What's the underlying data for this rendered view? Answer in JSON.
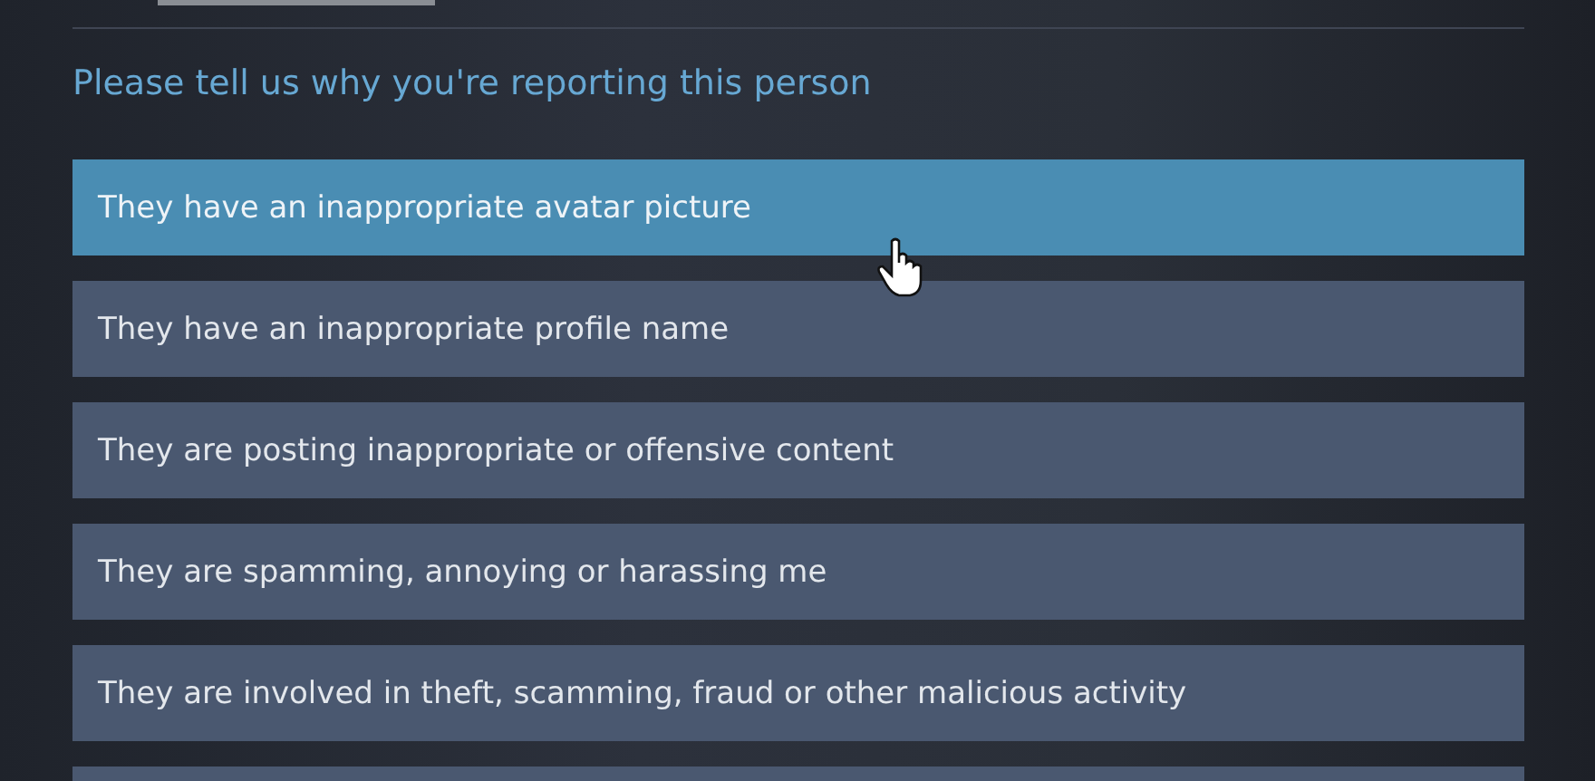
{
  "heading": "Please tell us why you're reporting this person",
  "options": [
    {
      "label": "They have an inappropriate avatar picture",
      "selected": true
    },
    {
      "label": "They have an inappropriate profile name",
      "selected": false
    },
    {
      "label": "They are posting inappropriate or offensive content",
      "selected": false
    },
    {
      "label": "They are spamming, annoying or harassing me",
      "selected": false
    },
    {
      "label": "They are involved in theft, scamming, fraud or other malicious activity",
      "selected": false
    }
  ]
}
